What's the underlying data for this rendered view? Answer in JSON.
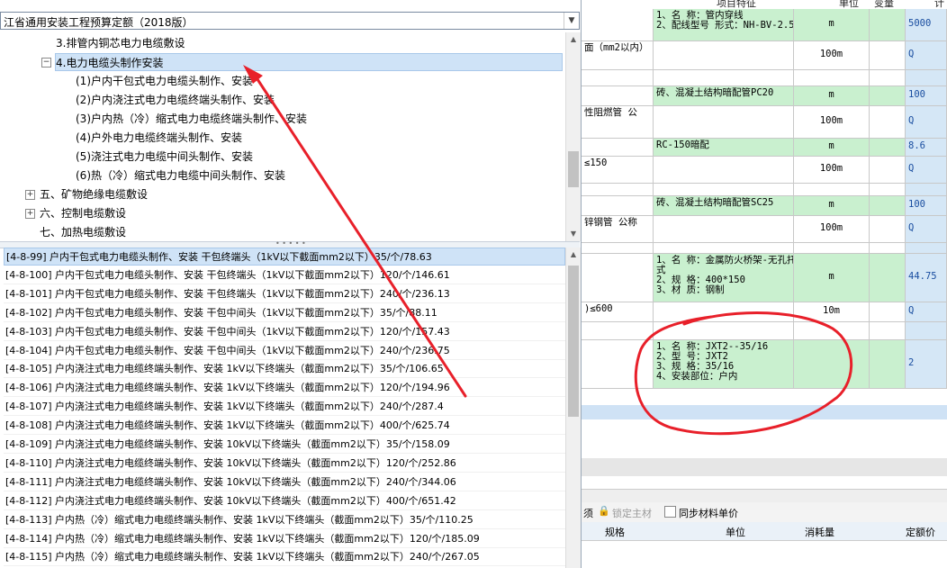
{
  "sheet": {
    "headers": {
      "feature": "项目特征",
      "unit": "单位",
      "change": "变量",
      "calc": "计"
    },
    "rows": [
      {
        "left": "",
        "feature": "1、名 称：管内穿线\n2、配线型号 形式：NH-BV-2.5",
        "unit": "m",
        "val": "5000",
        "green": true
      },
      {
        "left": "面（mm2以内）",
        "feature": "",
        "unit": "100m",
        "val": "Q",
        "green": false
      },
      {
        "left": "",
        "feature": "",
        "unit": "",
        "val": "",
        "green": false
      },
      {
        "left": "",
        "feature": "砖、混凝土结构暗配管PC20",
        "unit": "m",
        "val": "100",
        "green": true
      },
      {
        "left": "性阻燃管 公",
        "feature": "",
        "unit": "100m",
        "val": "Q",
        "green": false
      },
      {
        "left": "",
        "feature": "RC-150暗配",
        "unit": "m",
        "val": "8.6",
        "green": true
      },
      {
        "left": "≤150",
        "feature": "",
        "unit": "100m",
        "val": "Q",
        "green": false
      },
      {
        "left": "",
        "feature": "",
        "unit": "",
        "val": "",
        "green": false
      },
      {
        "left": "",
        "feature": "砖、混凝土结构暗配管SC25",
        "unit": "m",
        "val": "100",
        "green": true
      },
      {
        "left": "锌钢管 公称",
        "feature": "",
        "unit": "100m",
        "val": "Q",
        "green": false
      },
      {
        "left": "",
        "feature": "",
        "unit": "",
        "val": "",
        "green": false
      },
      {
        "left": "",
        "feature": "1、名 称：金属防火桥架-无孔托盘\n式\n2、规 格：400*150\n3、材 质：钢制",
        "unit": "m",
        "val": "44.75",
        "green": true
      },
      {
        "left": ")≤600",
        "feature": "",
        "unit": "10m",
        "val": "Q",
        "green": false
      },
      {
        "left": "",
        "feature": "",
        "unit": "",
        "val": "",
        "green": false
      },
      {
        "left": "",
        "feature": "1、名 称：JXT2--35/16\n2、型 号：JXT2\n3、规 格：35/16\n4、安装部位：户内",
        "unit": "",
        "val": "2",
        "green": true
      }
    ],
    "toolbar": {
      "lock_main": "锁定主材",
      "sync_price": "同步材料单价",
      "prefix": "须"
    },
    "bottom_headers": {
      "spec": "规格",
      "unit": "单位",
      "consumption": "消耗量",
      "quota_price": "定额价"
    }
  },
  "panel": {
    "combo_value": "江省通用安装工程预算定额（2018版）",
    "tree": [
      {
        "label": "3.排管内铜芯电力电缆敷设",
        "level": 2,
        "expander": "",
        "selected": false
      },
      {
        "label": "4.电力电缆头制作安装",
        "level": 2,
        "expander": "−",
        "selected": true
      },
      {
        "label": "(1)户内干包式电力电缆头制作、安装",
        "level": 3,
        "expander": "",
        "selected": false
      },
      {
        "label": "(2)户内浇注式电力电缆终端头制作、安装",
        "level": 3,
        "expander": "",
        "selected": false
      },
      {
        "label": "(3)户内热（冷）缩式电力电缆终端头制作、安装",
        "level": 3,
        "expander": "",
        "selected": false
      },
      {
        "label": "(4)户外电力电缆终端头制作、安装",
        "level": 3,
        "expander": "",
        "selected": false
      },
      {
        "label": "(5)浇注式电力电缆中间头制作、安装",
        "level": 3,
        "expander": "",
        "selected": false
      },
      {
        "label": "(6)热（冷）缩式电力电缆中间头制作、安装",
        "level": 3,
        "expander": "",
        "selected": false
      },
      {
        "label": "五、矿物绝缘电缆敷设",
        "level": 1,
        "expander": "+",
        "selected": false
      },
      {
        "label": "六、控制电缆敷设",
        "level": 1,
        "expander": "+",
        "selected": false
      },
      {
        "label": "七、加热电缆敷设",
        "level": 1,
        "expander": "",
        "selected": false
      }
    ],
    "list": [
      "[4-8-99] 户内干包式电力电缆头制作、安装 干包终端头（1kV以下截面mm2以下）35/个/78.63",
      "[4-8-100] 户内干包式电力电缆头制作、安装 干包终端头（1kV以下截面mm2以下）120/个/146.61",
      "[4-8-101] 户内干包式电力电缆头制作、安装 干包终端头（1kV以下截面mm2以下）240/个/236.13",
      "[4-8-102] 户内干包式电力电缆头制作、安装 干包中间头（1kV以下截面mm2以下）35/个/88.11",
      "[4-8-103] 户内干包式电力电缆头制作、安装 干包中间头（1kV以下截面mm2以下）120/个/157.43",
      "[4-8-104] 户内干包式电力电缆头制作、安装 干包中间头（1kV以下截面mm2以下）240/个/236.75",
      "[4-8-105] 户内浇注式电力电缆终端头制作、安装 1kV以下终端头（截面mm2以下）35/个/106.65",
      "[4-8-106] 户内浇注式电力电缆终端头制作、安装 1kV以下终端头（截面mm2以下）120/个/194.96",
      "[4-8-107] 户内浇注式电力电缆终端头制作、安装 1kV以下终端头（截面mm2以下）240/个/287.4",
      "[4-8-108] 户内浇注式电力电缆终端头制作、安装 1kV以下终端头（截面mm2以下）400/个/625.74",
      "[4-8-109] 户内浇注式电力电缆终端头制作、安装 10kV以下终端头（截面mm2以下）35/个/158.09",
      "[4-8-110] 户内浇注式电力电缆终端头制作、安装 10kV以下终端头（截面mm2以下）120/个/252.86",
      "[4-8-111] 户内浇注式电力电缆终端头制作、安装 10kV以下终端头（截面mm2以下）240/个/344.06",
      "[4-8-112] 户内浇注式电力电缆终端头制作、安装 10kV以下终端头（截面mm2以下）400/个/651.42",
      "[4-8-113] 户内热（冷）缩式电力电缆终端头制作、安装 1kV以下终端头（截面mm2以下）35/个/110.25",
      "[4-8-114] 户内热（冷）缩式电力电缆终端头制作、安装 1kV以下终端头（截面mm2以下）120/个/185.09",
      "[4-8-115] 户内热（冷）缩式电力电缆终端头制作、安装 1kV以下终端头（截面mm2以下）240/个/267.05"
    ]
  },
  "colors": {
    "annotation_red": "#e8202a",
    "selection_blue": "#cfe3f7",
    "feature_green": "#c9f0cf",
    "value_blue": "#d5e7f6"
  }
}
